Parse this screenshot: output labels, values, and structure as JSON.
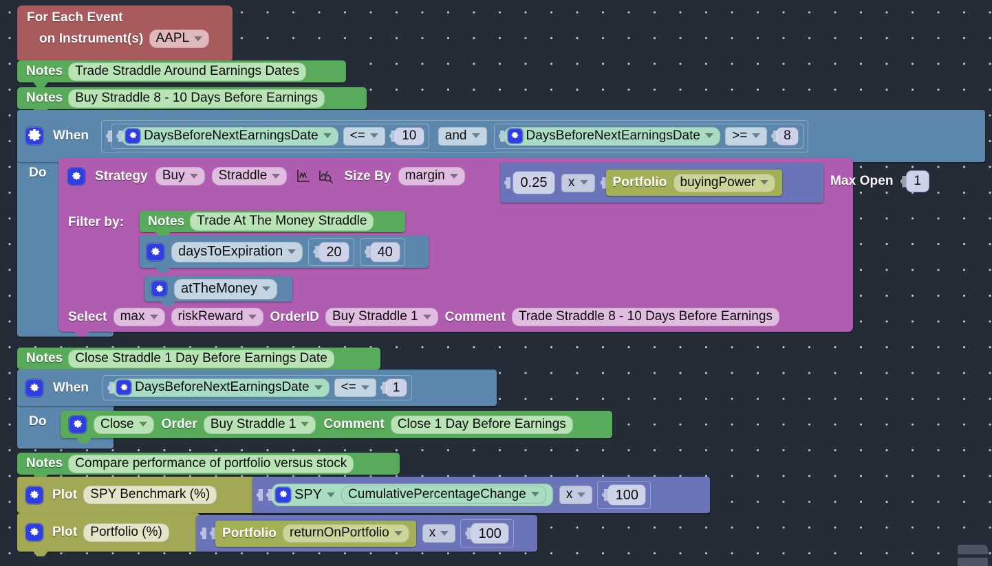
{
  "app": {
    "background_color": "#242c38",
    "grid_dot_color": "#b9c2cc"
  },
  "blocks": {
    "event": {
      "title": "For Each Event",
      "subtitle": "on Instrument(s)",
      "instrument": "AAPL",
      "color": "#a85a5c"
    },
    "notes": [
      {
        "label": "Notes",
        "text": "Trade Straddle Around Earnings Dates"
      },
      {
        "label": "Notes",
        "text": "Buy Straddle 8 - 10 Days Before Earnings"
      },
      {
        "label": "Notes",
        "text": "Trade At The Money Straddle"
      },
      {
        "label": "Notes",
        "text": "Close Straddle 1 Day Before Earnings Date"
      },
      {
        "label": "Notes",
        "text": "Compare performance of portfolio versus stock"
      }
    ],
    "when1": {
      "label": "When",
      "do_label": "Do",
      "condition_a": {
        "field": "DaysBeforeNextEarningsDate",
        "operator": "<=",
        "value": "10"
      },
      "joiner": "and",
      "condition_b": {
        "field": "DaysBeforeNextEarningsDate",
        "operator": ">=",
        "value": "8"
      },
      "color": "#5c87ad"
    },
    "strategy": {
      "label": "Strategy",
      "action": "Buy",
      "instrument_type": "Straddle",
      "size_by_label": "Size By",
      "size_by": "margin",
      "multiplier": "0.25",
      "operator": "x",
      "portfolio_label": "Portfolio",
      "portfolio_field": "buyingPower",
      "max_open_label": "Max Open",
      "max_open": "1",
      "filter_label": "Filter by:",
      "filters": [
        {
          "field": "daysToExpiration",
          "min": "20",
          "max": "40"
        },
        {
          "field": "atTheMoney"
        }
      ],
      "select_label": "Select",
      "select_mode": "max",
      "select_metric": "riskReward",
      "orderid_label": "OrderID",
      "orderid": "Buy Straddle 1",
      "comment_label": "Comment",
      "comment": "Trade Straddle 8 - 10 Days Before Earnings",
      "color": "#b05cb0"
    },
    "when2": {
      "label": "When",
      "do_label": "Do",
      "condition": {
        "field": "DaysBeforeNextEarningsDate",
        "operator": "<=",
        "value": "1"
      },
      "close_action": "Close",
      "order_label": "Order",
      "order": "Buy Straddle 1",
      "comment_label": "Comment",
      "comment": "Close 1 Day Before Earnings",
      "color": "#5c87ad"
    },
    "plots": [
      {
        "label": "Plot",
        "name": "SPY Benchmark (%)",
        "symbol": "SPY",
        "metric": "CumulativePercentageChange",
        "operator": "x",
        "value": "100"
      },
      {
        "label": "Plot",
        "name": "Portfolio (%)",
        "symbol": "Portfolio",
        "metric": "returnOnPortfolio",
        "operator": "x",
        "value": "100"
      }
    ]
  },
  "icons": {
    "gear": "gear-icon",
    "chart_line": "line-chart-icon",
    "chart_inspect": "chart-magnifier-icon",
    "dropdown": "chevron-down-icon"
  }
}
